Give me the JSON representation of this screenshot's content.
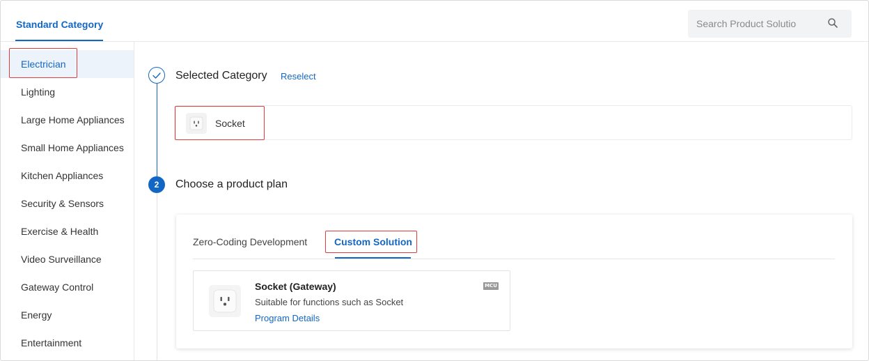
{
  "header": {
    "tab_label": "Standard Category",
    "search_placeholder": "Search Product Solutio"
  },
  "sidebar": {
    "items": [
      {
        "label": "Electrician"
      },
      {
        "label": "Lighting"
      },
      {
        "label": "Large Home Appliances"
      },
      {
        "label": "Small Home Appliances"
      },
      {
        "label": "Kitchen Appliances"
      },
      {
        "label": "Security & Sensors"
      },
      {
        "label": "Exercise & Health"
      },
      {
        "label": "Video Surveillance"
      },
      {
        "label": "Gateway Control"
      },
      {
        "label": "Energy"
      },
      {
        "label": "Entertainment"
      }
    ]
  },
  "steps": {
    "step1_title": "Selected Category",
    "reselect_label": "Reselect",
    "selected_item": "Socket",
    "step2_number": "2",
    "step2_title": "Choose a product plan"
  },
  "plan": {
    "tabs": [
      {
        "label": "Zero-Coding Development"
      },
      {
        "label": "Custom Solution"
      }
    ],
    "card": {
      "title": "Socket (Gateway)",
      "description": "Suitable for functions such as Socket",
      "link": "Program Details",
      "badge": "MCU"
    }
  },
  "colors": {
    "accent": "#1367c4",
    "highlight_outline": "#e03c3c",
    "active_bg": "#edf3fb"
  }
}
